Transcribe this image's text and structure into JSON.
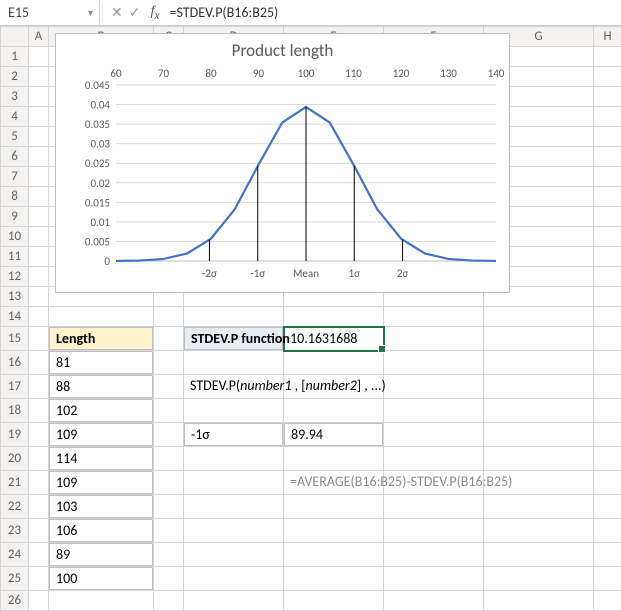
{
  "formula_bar": {
    "cell_ref": "E15",
    "formula": "=STDEV.P(B16:B25)"
  },
  "columns": [
    "A",
    "B",
    "C",
    "D",
    "E",
    "F",
    "G",
    "H"
  ],
  "rows": [
    "1",
    "2",
    "3",
    "4",
    "5",
    "6",
    "7",
    "8",
    "9",
    "10",
    "11",
    "12",
    "13",
    "14",
    "15",
    "16",
    "17",
    "18",
    "19",
    "20",
    "21",
    "22",
    "23",
    "24",
    "25",
    "26"
  ],
  "cells": {
    "B15": "Length",
    "B16": "81",
    "B17": "88",
    "B18": "102",
    "B19": "109",
    "B20": "114",
    "B21": "109",
    "B22": "103",
    "B23": "106",
    "B24": "89",
    "B25": "100",
    "D15": "STDEV.P function",
    "E15": "10.1631688",
    "D17_syntax_a": "STDEV.P(",
    "D17_syntax_b": "number1",
    "D17_syntax_c": " , [",
    "D17_syntax_d": "number2",
    "D17_syntax_e": "] , ...)",
    "D19": "-1σ",
    "E19": "89.94",
    "E21": "=AVERAGE(B16:B25)-STDEV.P(B16:B25)"
  },
  "chart_data": {
    "type": "line",
    "title": "Product length",
    "xlabel": "",
    "ylabel": "",
    "xlim": [
      60,
      140
    ],
    "ylim": [
      0,
      0.045
    ],
    "x_ticks": [
      60,
      70,
      80,
      90,
      100,
      110,
      120,
      130,
      140
    ],
    "y_ticks": [
      0,
      0.005,
      0.01,
      0.015,
      0.02,
      0.025,
      0.03,
      0.035,
      0.04,
      0.045
    ],
    "series": [
      {
        "name": "density",
        "color": "#4472c4",
        "x": [
          60,
          65,
          70,
          75,
          80,
          85,
          90,
          95,
          100,
          105,
          110,
          115,
          120,
          125,
          130,
          135,
          140
        ],
        "values": [
          1.7e-05,
          0.00011,
          0.00052,
          0.00193,
          0.00572,
          0.01322,
          0.02462,
          0.0354,
          0.0394,
          0.0354,
          0.02462,
          0.01322,
          0.00572,
          0.00193,
          0.00052,
          0.00011,
          1.7e-05
        ]
      }
    ],
    "annotations": [
      {
        "label": "-2σ",
        "x": 79.67
      },
      {
        "label": "-1σ",
        "x": 89.84
      },
      {
        "label": "Mean",
        "x": 100.0
      },
      {
        "label": "1σ",
        "x": 110.16
      },
      {
        "label": "2σ",
        "x": 120.33
      }
    ]
  }
}
